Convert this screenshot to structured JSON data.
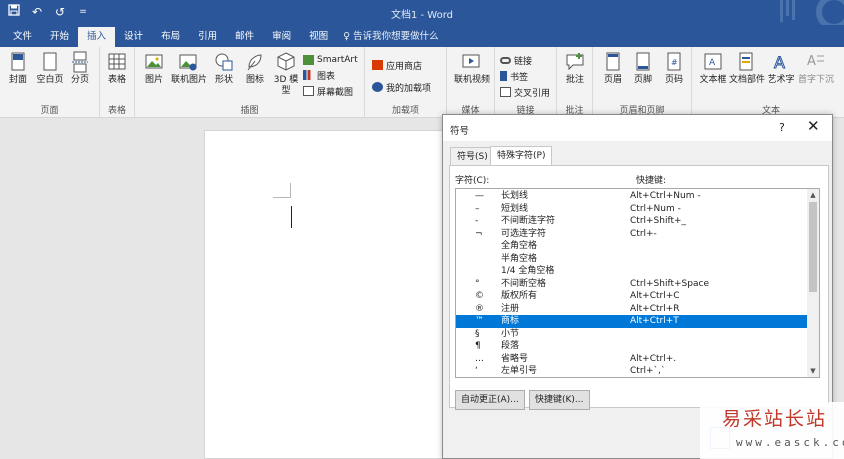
{
  "window": {
    "title": "文档1 - Word"
  },
  "qat": {
    "save_icon": "save-icon",
    "undo": "↶",
    "redo": "↺",
    "more": "="
  },
  "tabs": [
    {
      "label": "文件"
    },
    {
      "label": "开始"
    },
    {
      "label": "插入"
    },
    {
      "label": "设计"
    },
    {
      "label": "布局"
    },
    {
      "label": "引用"
    },
    {
      "label": "邮件"
    },
    {
      "label": "审阅"
    },
    {
      "label": "视图"
    }
  ],
  "tell_me": "告诉我你想要做什么",
  "ribbon": {
    "pages": {
      "cover": "封面",
      "blank": "空白页",
      "break": "分页",
      "label": "页面"
    },
    "tables": {
      "table": "表格",
      "label": "表格"
    },
    "illustrations": {
      "picture": "图片",
      "online_picture": "联机图片",
      "shapes": "形状",
      "icons": "图标",
      "model3d_line1": "3D 模",
      "model3d_line2": "型",
      "smartart": "SmartArt",
      "chart": "图表",
      "screenshot": "屏幕截图",
      "label": "插图"
    },
    "addins": {
      "store": "应用商店",
      "my_addins": "我的加载项",
      "label": "加载项"
    },
    "media": {
      "online_video": "联机视频",
      "label": "媒体"
    },
    "links": {
      "link": "链接",
      "bookmark": "书签",
      "crossref": "交叉引用",
      "label": "链接"
    },
    "comments": {
      "comment": "批注",
      "label": "批注"
    },
    "header_footer": {
      "header": "页眉",
      "footer": "页脚",
      "page_number": "页码",
      "label": "页眉和页脚"
    },
    "text": {
      "textbox": "文本框",
      "quickparts": "文档部件",
      "wordart": "艺术字",
      "dropcap": "首字下沉",
      "label": "文本"
    }
  },
  "dialog": {
    "title": "符号",
    "help": "?",
    "close": "✕",
    "tabs": [
      {
        "label": "符号(S)"
      },
      {
        "label": "特殊字符(P)"
      }
    ],
    "col_char": "字符(C):",
    "col_shortcut": "快捷键:",
    "rows": [
      {
        "sym": "—",
        "name": "长划线",
        "key": "Alt+Ctrl+Num -"
      },
      {
        "sym": "–",
        "name": "短划线",
        "key": "Ctrl+Num -"
      },
      {
        "sym": "‑",
        "name": "不间断连字符",
        "key": "Ctrl+Shift+_"
      },
      {
        "sym": "¬",
        "name": "可选连字符",
        "key": "Ctrl+-"
      },
      {
        "sym": "",
        "name": "全角空格",
        "key": ""
      },
      {
        "sym": "",
        "name": "半角空格",
        "key": ""
      },
      {
        "sym": "",
        "name": "1/4 全角空格",
        "key": ""
      },
      {
        "sym": "°",
        "name": "不间断空格",
        "key": "Ctrl+Shift+Space"
      },
      {
        "sym": "©",
        "name": "版权所有",
        "key": "Alt+Ctrl+C"
      },
      {
        "sym": "®",
        "name": "注册",
        "key": "Alt+Ctrl+R"
      },
      {
        "sym": "™",
        "name": "商标",
        "key": "Alt+Ctrl+T"
      },
      {
        "sym": "§",
        "name": "小节",
        "key": ""
      },
      {
        "sym": "¶",
        "name": "段落",
        "key": ""
      },
      {
        "sym": "…",
        "name": "省略号",
        "key": "Alt+Ctrl+."
      },
      {
        "sym": "‘",
        "name": "左单引号",
        "key": "Ctrl+`,`"
      }
    ],
    "selected_row": 10,
    "autocorrect_button": "自动更正(A)...",
    "shortcut_button": "快捷键(K)..."
  },
  "watermark": {
    "cn": "易采站长站",
    "url": "www.easck.com"
  }
}
